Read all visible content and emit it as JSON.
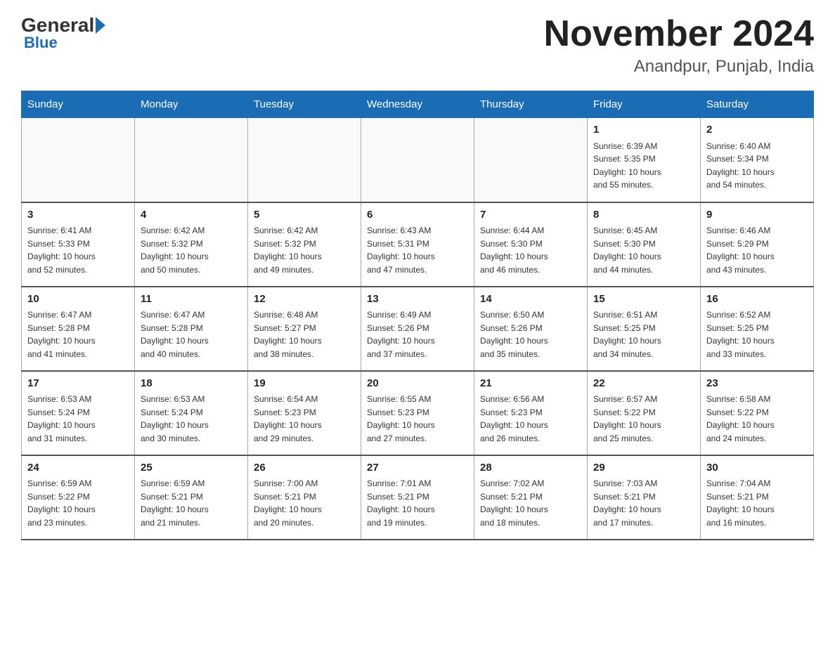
{
  "header": {
    "logo_general": "General",
    "logo_blue": "Blue",
    "month_title": "November 2024",
    "location": "Anandpur, Punjab, India"
  },
  "weekdays": [
    "Sunday",
    "Monday",
    "Tuesday",
    "Wednesday",
    "Thursday",
    "Friday",
    "Saturday"
  ],
  "weeks": [
    [
      {
        "day": "",
        "info": ""
      },
      {
        "day": "",
        "info": ""
      },
      {
        "day": "",
        "info": ""
      },
      {
        "day": "",
        "info": ""
      },
      {
        "day": "",
        "info": ""
      },
      {
        "day": "1",
        "info": "Sunrise: 6:39 AM\nSunset: 5:35 PM\nDaylight: 10 hours\nand 55 minutes."
      },
      {
        "day": "2",
        "info": "Sunrise: 6:40 AM\nSunset: 5:34 PM\nDaylight: 10 hours\nand 54 minutes."
      }
    ],
    [
      {
        "day": "3",
        "info": "Sunrise: 6:41 AM\nSunset: 5:33 PM\nDaylight: 10 hours\nand 52 minutes."
      },
      {
        "day": "4",
        "info": "Sunrise: 6:42 AM\nSunset: 5:32 PM\nDaylight: 10 hours\nand 50 minutes."
      },
      {
        "day": "5",
        "info": "Sunrise: 6:42 AM\nSunset: 5:32 PM\nDaylight: 10 hours\nand 49 minutes."
      },
      {
        "day": "6",
        "info": "Sunrise: 6:43 AM\nSunset: 5:31 PM\nDaylight: 10 hours\nand 47 minutes."
      },
      {
        "day": "7",
        "info": "Sunrise: 6:44 AM\nSunset: 5:30 PM\nDaylight: 10 hours\nand 46 minutes."
      },
      {
        "day": "8",
        "info": "Sunrise: 6:45 AM\nSunset: 5:30 PM\nDaylight: 10 hours\nand 44 minutes."
      },
      {
        "day": "9",
        "info": "Sunrise: 6:46 AM\nSunset: 5:29 PM\nDaylight: 10 hours\nand 43 minutes."
      }
    ],
    [
      {
        "day": "10",
        "info": "Sunrise: 6:47 AM\nSunset: 5:28 PM\nDaylight: 10 hours\nand 41 minutes."
      },
      {
        "day": "11",
        "info": "Sunrise: 6:47 AM\nSunset: 5:28 PM\nDaylight: 10 hours\nand 40 minutes."
      },
      {
        "day": "12",
        "info": "Sunrise: 6:48 AM\nSunset: 5:27 PM\nDaylight: 10 hours\nand 38 minutes."
      },
      {
        "day": "13",
        "info": "Sunrise: 6:49 AM\nSunset: 5:26 PM\nDaylight: 10 hours\nand 37 minutes."
      },
      {
        "day": "14",
        "info": "Sunrise: 6:50 AM\nSunset: 5:26 PM\nDaylight: 10 hours\nand 35 minutes."
      },
      {
        "day": "15",
        "info": "Sunrise: 6:51 AM\nSunset: 5:25 PM\nDaylight: 10 hours\nand 34 minutes."
      },
      {
        "day": "16",
        "info": "Sunrise: 6:52 AM\nSunset: 5:25 PM\nDaylight: 10 hours\nand 33 minutes."
      }
    ],
    [
      {
        "day": "17",
        "info": "Sunrise: 6:53 AM\nSunset: 5:24 PM\nDaylight: 10 hours\nand 31 minutes."
      },
      {
        "day": "18",
        "info": "Sunrise: 6:53 AM\nSunset: 5:24 PM\nDaylight: 10 hours\nand 30 minutes."
      },
      {
        "day": "19",
        "info": "Sunrise: 6:54 AM\nSunset: 5:23 PM\nDaylight: 10 hours\nand 29 minutes."
      },
      {
        "day": "20",
        "info": "Sunrise: 6:55 AM\nSunset: 5:23 PM\nDaylight: 10 hours\nand 27 minutes."
      },
      {
        "day": "21",
        "info": "Sunrise: 6:56 AM\nSunset: 5:23 PM\nDaylight: 10 hours\nand 26 minutes."
      },
      {
        "day": "22",
        "info": "Sunrise: 6:57 AM\nSunset: 5:22 PM\nDaylight: 10 hours\nand 25 minutes."
      },
      {
        "day": "23",
        "info": "Sunrise: 6:58 AM\nSunset: 5:22 PM\nDaylight: 10 hours\nand 24 minutes."
      }
    ],
    [
      {
        "day": "24",
        "info": "Sunrise: 6:59 AM\nSunset: 5:22 PM\nDaylight: 10 hours\nand 23 minutes."
      },
      {
        "day": "25",
        "info": "Sunrise: 6:59 AM\nSunset: 5:21 PM\nDaylight: 10 hours\nand 21 minutes."
      },
      {
        "day": "26",
        "info": "Sunrise: 7:00 AM\nSunset: 5:21 PM\nDaylight: 10 hours\nand 20 minutes."
      },
      {
        "day": "27",
        "info": "Sunrise: 7:01 AM\nSunset: 5:21 PM\nDaylight: 10 hours\nand 19 minutes."
      },
      {
        "day": "28",
        "info": "Sunrise: 7:02 AM\nSunset: 5:21 PM\nDaylight: 10 hours\nand 18 minutes."
      },
      {
        "day": "29",
        "info": "Sunrise: 7:03 AM\nSunset: 5:21 PM\nDaylight: 10 hours\nand 17 minutes."
      },
      {
        "day": "30",
        "info": "Sunrise: 7:04 AM\nSunset: 5:21 PM\nDaylight: 10 hours\nand 16 minutes."
      }
    ]
  ]
}
